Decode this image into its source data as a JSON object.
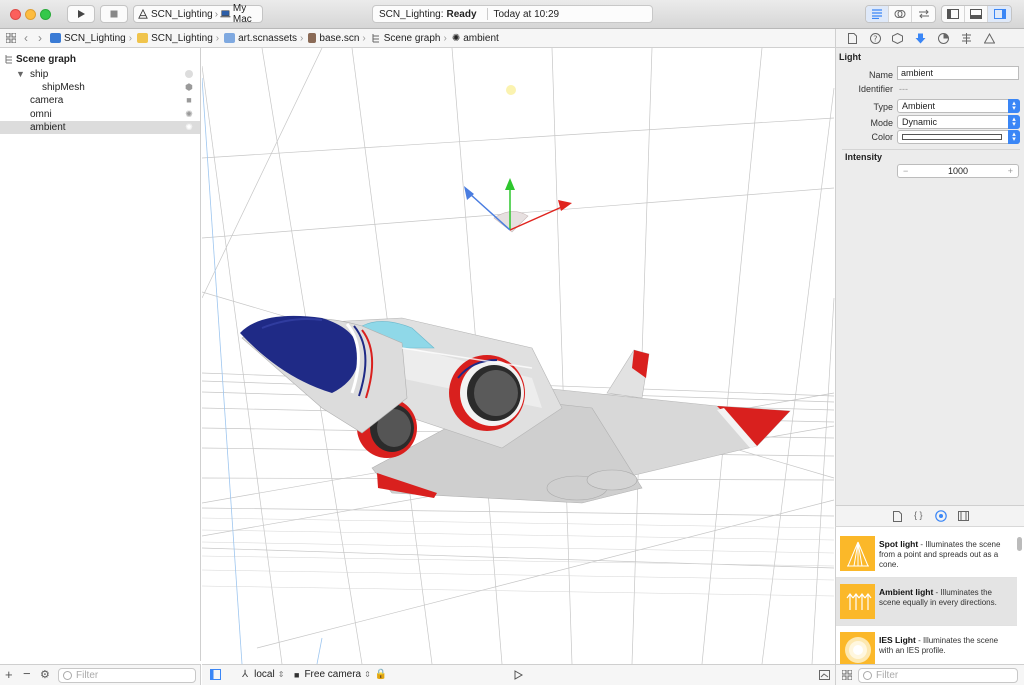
{
  "toolbar": {
    "scheme_target": "SCN_Lighting",
    "scheme_device": "My Mac",
    "activity_project": "SCN_Lighting:",
    "activity_status": "Ready",
    "activity_time": "Today at 10:29"
  },
  "jumpbar": {
    "crumbs": [
      "SCN_Lighting",
      "SCN_Lighting",
      "art.scnassets",
      "base.scn",
      "Scene graph",
      "ambient"
    ]
  },
  "navigator": {
    "title": "Scene graph",
    "items": [
      {
        "label": "ship"
      },
      {
        "label": "shipMesh"
      },
      {
        "label": "camera"
      },
      {
        "label": "omni"
      },
      {
        "label": "ambient"
      }
    ],
    "filter_placeholder": "Filter"
  },
  "inspector": {
    "section_light": "Light",
    "name_label": "Name",
    "name_value": "ambient",
    "identifier_label": "Identifier",
    "identifier_value": "---",
    "type_label": "Type",
    "type_value": "Ambient",
    "mode_label": "Mode",
    "mode_value": "Dynamic",
    "color_label": "Color",
    "color_value": "#ffffff",
    "section_intensity": "Intensity",
    "intensity_value": "1000"
  },
  "library": {
    "items": [
      {
        "title": "Spot light",
        "desc": " - Illuminates the scene from a point and spreads out as a cone."
      },
      {
        "title": "Ambient light",
        "desc": " - Illuminates the scene equally in every directions."
      },
      {
        "title": "IES Light",
        "desc": " - Illuminates the scene with an IES profile."
      }
    ],
    "filter_placeholder": "Filter"
  },
  "viewport_footer": {
    "space": "local",
    "camera": "Free camera"
  },
  "colors": {
    "accent": "#3a86f6",
    "library_icon": "#fbb829",
    "ship_nose": "#1f2a86",
    "ship_stripe": "#d9201e"
  }
}
